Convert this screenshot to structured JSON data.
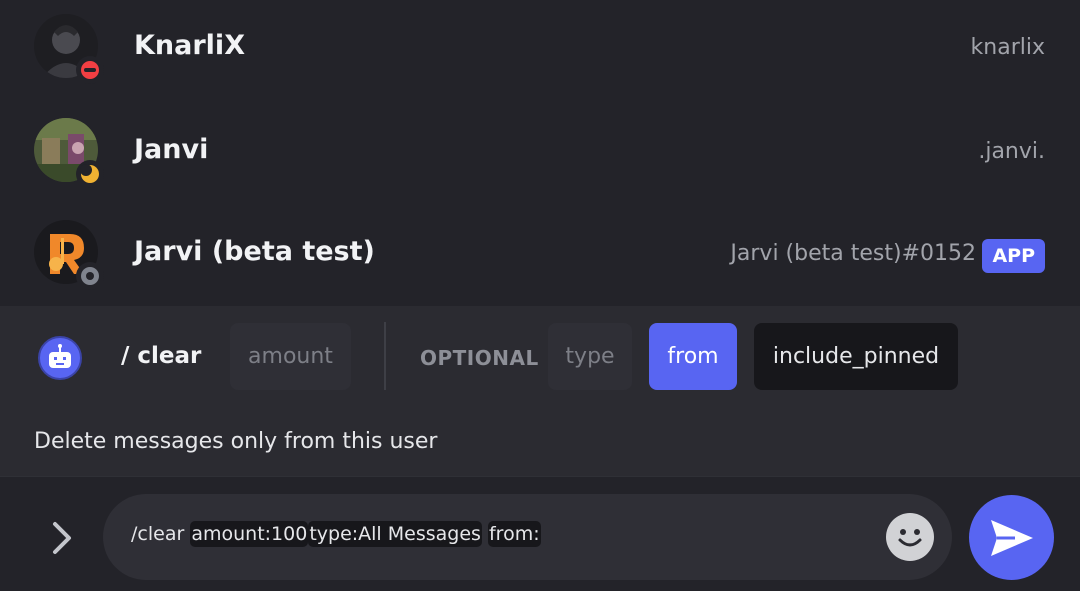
{
  "members": [
    {
      "name": "KnarliX",
      "username": "knarlix",
      "status": "dnd",
      "status_color": "#f23f43",
      "avatar_color": "#3a3a40"
    },
    {
      "name": "Janvi",
      "username": ".janvi.",
      "status": "idle",
      "status_color": "#f0b232",
      "avatar_color": "#4e5a3a"
    },
    {
      "name": "Jarvi (beta test)",
      "username": "Jarvi (beta test)#0152",
      "badge": "APP",
      "status": "offline",
      "status_color": "#80848e",
      "avatar_color": "#2a2a2e"
    }
  ],
  "command": {
    "name": "/ clear",
    "options": {
      "amount": "amount",
      "optional_label": "OPTIONAL",
      "type": "type",
      "from": "from",
      "include_pinned": "include_pinned"
    },
    "selected_option": "from",
    "description": "Delete messages only from this user"
  },
  "composer": {
    "command_text": "/clear",
    "arg_amount": "amount:100",
    "arg_type": "type:All Messages",
    "arg_from": "from:"
  },
  "colors": {
    "accent": "#5865f2",
    "background": "#232329",
    "panel": "#2b2b31"
  },
  "icons": {
    "expand": "chevron-right-icon",
    "emoji": "emoji-smile-icon",
    "send": "send-icon",
    "bot": "bot-icon"
  }
}
